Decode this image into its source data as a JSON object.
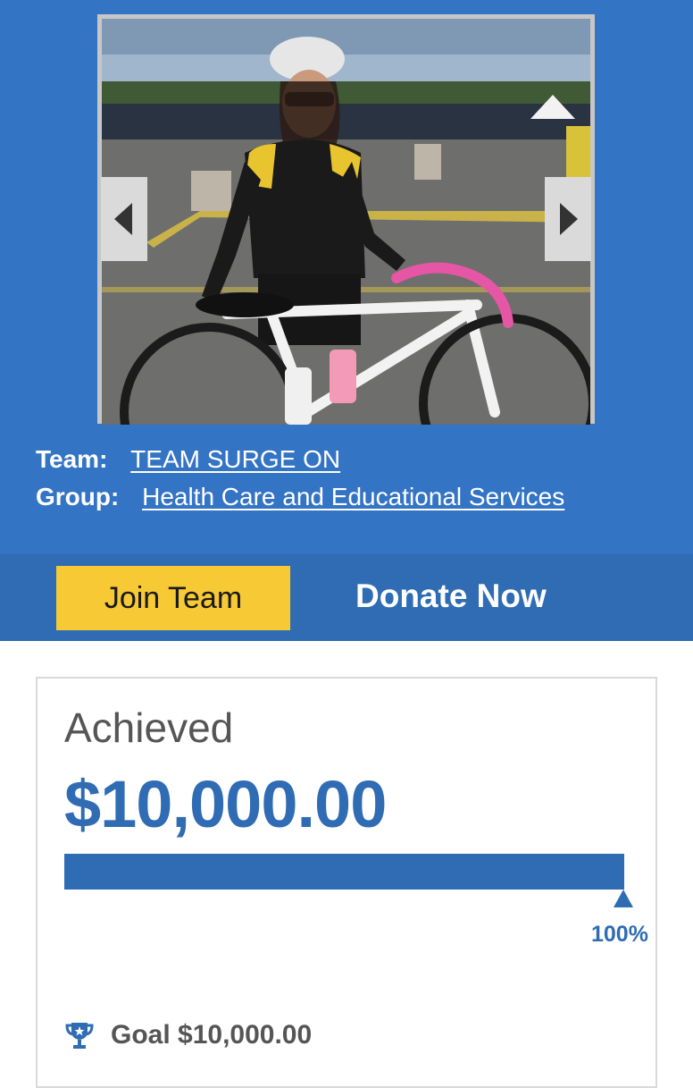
{
  "photo": {
    "alt": "Cyclist with white road bike at event start line"
  },
  "carousel": {
    "prev_icon": "caret-left-icon",
    "next_icon": "caret-right-icon"
  },
  "team": {
    "label": "Team:",
    "name": "TEAM SURGE ON"
  },
  "group": {
    "label": "Group:",
    "name": "Health Care and Educational Services"
  },
  "actions": {
    "join_label": "Join Team",
    "donate_label": "Donate Now"
  },
  "progress": {
    "achieved_label": "Achieved",
    "achieved_amount": "$10,000.00",
    "percent_label": "100%",
    "fraction": 1.0,
    "goal_label": "Goal $10,000.00"
  },
  "colors": {
    "brand_blue": "#3474c5",
    "accent_yellow": "#f7c935",
    "progress_blue": "#2f6cb3"
  }
}
